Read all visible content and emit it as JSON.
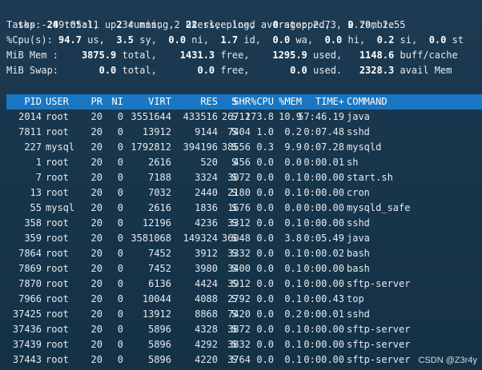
{
  "summary": {
    "line1": {
      "pre": "top - 09:05:11 up 34 min,  2 users,  load average: 2.73, 2.79, 2.55"
    },
    "tasks": {
      "label": "Tasks:",
      "total": "24",
      "total_lbl": "total,",
      "running": "2",
      "running_lbl": "running,",
      "sleeping": "22",
      "sleeping_lbl": "sleeping,",
      "stopped": "0",
      "stopped_lbl": "stopped,",
      "zombie": "0",
      "zombie_lbl": "zombie"
    },
    "cpu": {
      "label": "%Cpu(s):",
      "us": "94.7",
      "us_lbl": "us,",
      "sy": "3.5",
      "sy_lbl": "sy,",
      "ni": "0.0",
      "ni_lbl": "ni,",
      "id": "1.7",
      "id_lbl": "id,",
      "wa": "0.0",
      "wa_lbl": "wa,",
      "hi": "0.0",
      "hi_lbl": "hi,",
      "si": "0.2",
      "si_lbl": "si,",
      "st": "0.0",
      "st_lbl": "st"
    },
    "mem": {
      "label": "MiB Mem :",
      "total": "3875.9",
      "total_lbl": "total,",
      "free": "1431.3",
      "free_lbl": "free,",
      "used": "1295.9",
      "used_lbl": "used,",
      "buff": "1148.6",
      "buff_lbl": "buff/cache"
    },
    "swap": {
      "label": "MiB Swap:",
      "total": "0.0",
      "total_lbl": "total,",
      "free": "0.0",
      "free_lbl": "free,",
      "used": "0.0",
      "used_lbl": "used.",
      "avail": "2328.3",
      "avail_lbl": "avail Mem"
    }
  },
  "columns": [
    "PID",
    "USER",
    "PR",
    "NI",
    "VIRT",
    "RES",
    "SHR",
    "S",
    "%CPU",
    "%MEM",
    "TIME+",
    "COMMAND"
  ],
  "processes": [
    [
      "2014",
      "root",
      "20",
      "0",
      "3551644",
      "433516",
      "26712",
      "S",
      "173.8",
      "10.9",
      "57:46.19",
      "java"
    ],
    [
      "7811",
      "root",
      "20",
      "0",
      "13912",
      "9144",
      "7404",
      "S",
      "1.0",
      "0.2",
      "0:07.48",
      "sshd"
    ],
    [
      "227",
      "mysql",
      "20",
      "0",
      "1792812",
      "394196",
      "38556",
      "S",
      "0.3",
      "9.9",
      "0:07.28",
      "mysqld"
    ],
    [
      "1",
      "root",
      "20",
      "0",
      "2616",
      "520",
      "456",
      "S",
      "0.0",
      "0.0",
      "0:00.01",
      "sh"
    ],
    [
      "7",
      "root",
      "20",
      "0",
      "7188",
      "3324",
      "3072",
      "S",
      "0.0",
      "0.1",
      "0:00.00",
      "start.sh"
    ],
    [
      "13",
      "root",
      "20",
      "0",
      "7032",
      "2440",
      "2180",
      "S",
      "0.0",
      "0.1",
      "0:00.00",
      "cron"
    ],
    [
      "55",
      "mysql",
      "20",
      "0",
      "2616",
      "1836",
      "1676",
      "S",
      "0.0",
      "0.0",
      "0:00.00",
      "mysqld_safe"
    ],
    [
      "358",
      "root",
      "20",
      "0",
      "12196",
      "4236",
      "3312",
      "S",
      "0.0",
      "0.1",
      "0:00.00",
      "sshd"
    ],
    [
      "359",
      "root",
      "20",
      "0",
      "3581068",
      "149324",
      "36048",
      "S",
      "0.0",
      "3.8",
      "0:05.49",
      "java"
    ],
    [
      "7864",
      "root",
      "20",
      "0",
      "7452",
      "3912",
      "3332",
      "S",
      "0.0",
      "0.1",
      "0:00.02",
      "bash"
    ],
    [
      "7869",
      "root",
      "20",
      "0",
      "7452",
      "3980",
      "3400",
      "S",
      "0.0",
      "0.1",
      "0:00.00",
      "bash"
    ],
    [
      "7870",
      "root",
      "20",
      "0",
      "6136",
      "4424",
      "3912",
      "S",
      "0.0",
      "0.1",
      "0:00.00",
      "sftp-server"
    ],
    [
      "7966",
      "root",
      "20",
      "0",
      "10044",
      "4088",
      "2792",
      "S",
      "0.0",
      "0.1",
      "0:00.43",
      "top"
    ],
    [
      "37425",
      "root",
      "20",
      "0",
      "13912",
      "8868",
      "7420",
      "S",
      "0.0",
      "0.2",
      "0:00.01",
      "sshd"
    ],
    [
      "37436",
      "root",
      "20",
      "0",
      "5896",
      "4328",
      "3872",
      "S",
      "0.0",
      "0.1",
      "0:00.00",
      "sftp-server"
    ],
    [
      "37439",
      "root",
      "20",
      "0",
      "5896",
      "4292",
      "3832",
      "S",
      "0.0",
      "0.1",
      "0:00.00",
      "sftp-server"
    ],
    [
      "37443",
      "root",
      "20",
      "0",
      "5896",
      "4220",
      "3764",
      "S",
      "0.0",
      "0.1",
      "0:00.00",
      "sftp-server"
    ]
  ],
  "watermark": "CSDN @Z3r4y",
  "colors": {
    "header_bar": "#1976c2",
    "background": "#17354b",
    "text": "#e6e9ec"
  }
}
